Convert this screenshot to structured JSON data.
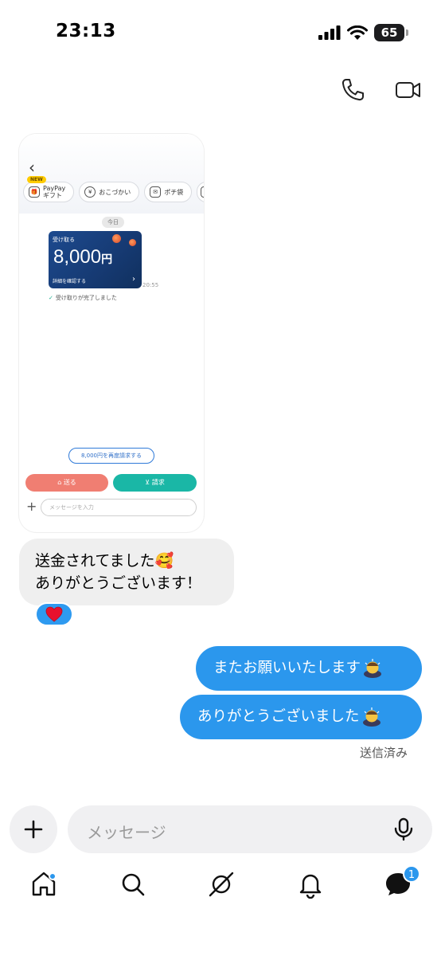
{
  "status_bar": {
    "time": "23:13",
    "battery": "65"
  },
  "shared_image": {
    "chips": [
      {
        "label": "PayPay\nギフト",
        "badge": "NEW"
      },
      {
        "label": "おこづかい"
      },
      {
        "label": "ポチ袋"
      }
    ],
    "date_label": "今日",
    "pay_card": {
      "receive_label": "受け取る",
      "amount": "8,000",
      "currency": "円",
      "detail_label": "詳細を確認する"
    },
    "time": "20:55",
    "received_text": "受け取りが完了しました",
    "rerequest_label": "8,000円を再度請求する",
    "send_label": "送る",
    "request_label": "請求",
    "input_placeholder": "メッセージを入力"
  },
  "messages": {
    "incoming": {
      "line1": "送金されてました🥰",
      "line2": "ありがとうございます！"
    },
    "reaction": "❤️",
    "outgoing": [
      {
        "text": "またお願いいたします"
      },
      {
        "text": "ありがとうございました"
      }
    ],
    "status": "送信済み"
  },
  "compose": {
    "placeholder": "メッセージ"
  },
  "nav": {
    "items": [
      "home-icon",
      "search-icon",
      "explore-icon",
      "bell-icon",
      "messages-icon"
    ],
    "messages_badge": "1"
  },
  "colors": {
    "accent": "#2b97ed",
    "incoming_bubble": "#efefef",
    "paypay_card": "#163a73"
  }
}
